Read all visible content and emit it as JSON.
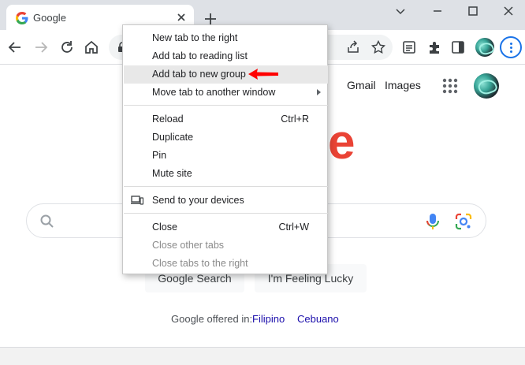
{
  "colors": {
    "tabstrip_bg": "#dee1e6",
    "accent": "#1a73e8",
    "google_red": "#ea4335",
    "link_blue": "#1a0dab",
    "menu_highlight": "#e8e8e8",
    "annotation_arrow": "#ff0000"
  },
  "tab": {
    "title": "Google",
    "favicon": "google-g-icon"
  },
  "toolbar": {
    "icons": [
      "back-icon",
      "forward-icon",
      "reload-icon",
      "home-icon",
      "lock-icon",
      "share-icon",
      "star-icon",
      "tab-search-icon",
      "extensions-icon",
      "side-panel-icon",
      "profile-avatar",
      "kebab-menu-icon"
    ]
  },
  "page": {
    "gmail": "Gmail",
    "images": "Images",
    "logo_visible": "e",
    "search_button": "Google Search",
    "lucky_button": "I'm Feeling Lucky",
    "offered_in": "Google offered in:",
    "languages": [
      "Filipino",
      "Cebuano"
    ]
  },
  "context_menu": {
    "items": [
      {
        "label": "New tab to the right",
        "shortcut": "",
        "state": "normal"
      },
      {
        "label": "Add tab to reading list",
        "shortcut": "",
        "state": "normal"
      },
      {
        "label": "Add tab to new group",
        "shortcut": "",
        "state": "highlighted"
      },
      {
        "label": "Move tab to another window",
        "shortcut": "",
        "state": "submenu"
      },
      {
        "label": "Reload",
        "shortcut": "Ctrl+R",
        "state": "normal"
      },
      {
        "label": "Duplicate",
        "shortcut": "",
        "state": "normal"
      },
      {
        "label": "Pin",
        "shortcut": "",
        "state": "normal"
      },
      {
        "label": "Mute site",
        "shortcut": "",
        "state": "normal"
      },
      {
        "label": "Send to your devices",
        "shortcut": "",
        "state": "normal",
        "icon": "devices-icon"
      },
      {
        "label": "Close",
        "shortcut": "Ctrl+W",
        "state": "normal"
      },
      {
        "label": "Close other tabs",
        "shortcut": "",
        "state": "disabled"
      },
      {
        "label": "Close tabs to the right",
        "shortcut": "",
        "state": "disabled"
      }
    ]
  }
}
